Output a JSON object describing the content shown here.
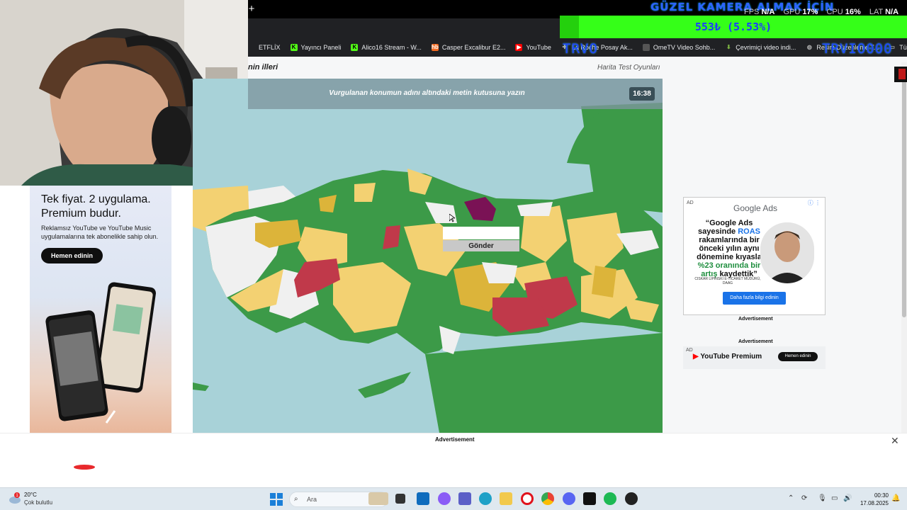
{
  "browser": {
    "new_tab": "+",
    "bookmarks": [
      {
        "label": "ETFLİX",
        "icon": "netflix-icon",
        "color": "#e50914"
      },
      {
        "label": "Yayıncı Paneli",
        "icon": "kick-icon",
        "color": "#53fc18"
      },
      {
        "label": "Alico16 Stream - W...",
        "icon": "kick-icon",
        "color": "#53fc18"
      },
      {
        "label": "Casper Excalibur E2...",
        "icon": "hb-icon",
        "color": "#f26a21"
      },
      {
        "label": "YouTube",
        "icon": "youtube-icon",
        "color": "#ff0000"
      },
      {
        "label": "La Roche Posay Ak...",
        "icon": "plus-icon",
        "color": "#7a7a7a"
      },
      {
        "label": "OmeTV Video Sohb...",
        "icon": "video-icon",
        "color": "#7a7a7a"
      },
      {
        "label": "Çevrimiçi video indi...",
        "icon": "download-icon",
        "color": "#7cb342"
      },
      {
        "label": "Resim Düzenleme T...",
        "icon": "globe-icon",
        "color": "#888888"
      },
      {
        "label": "Tüm Yer İşaretleri",
        "icon": "folder-icon",
        "color": "#888888"
      }
    ]
  },
  "stream": {
    "title": "GÜZEL KAMERA ALMAK İÇİN",
    "goal": "553₺ (5.53%)",
    "goal_progress": 0.0553,
    "perf": {
      "fps_label": "FPS",
      "fps": "N/A",
      "gpu_label": "GPU",
      "gpu": "17%",
      "cpu_label": "CPU",
      "cpu": "16%",
      "lat_label": "LAT",
      "lat": "N/A"
    },
    "overlay_left": "TRVO",
    "overlay_right": "TRVIO000"
  },
  "page": {
    "title": "nin illeri",
    "site_link": "Harita Test Oyunları",
    "question": "Vurgulanan konumun adını altındaki metin kutusuna yazın",
    "timer": "16:38",
    "answer_value": "",
    "submit_label": "Gönder"
  },
  "left_ad": {
    "headline": "Tek fiyat. 2 uygulama. Premium budur.",
    "body": "Reklamsız YouTube ve YouTube Music uygulamalarına tek abonelikle sahip olun.",
    "cta": "Hemen edinin"
  },
  "google_ad": {
    "ad_tag": "AD",
    "logo": "Google Ads",
    "line1": "“Google Ads sayesinde ",
    "line1b": "ROAS",
    "line2": " rakamlarında bir önceki yılın aynı dönemine kıyasla ",
    "line2b": "%23 oranında bir artış",
    "line3": " kaydettik”",
    "signature": "CISKAR LIPINSKI  E-TICARET MÜDÜRÜ, DAAG",
    "cta": "Daha fazla bilgi edinin",
    "label": "Advertisement"
  },
  "ytp_ad": {
    "ad_tag": "AD",
    "label": "Advertisement",
    "brand": "YouTube Premium",
    "cta": "Hemen edinin"
  },
  "bottom_ad": {
    "label": "Advertisement",
    "close": "✕"
  },
  "taskbar": {
    "temp": "20°C",
    "weather": "Çok bulutlu",
    "weather_badge": "1",
    "search_label": "Ara",
    "time": "00:30",
    "date": "17.08.2025"
  },
  "colors": {
    "sea": "#a8d2d8",
    "green": "#3c9a48",
    "yellow": "#f3d172",
    "gold": "#dcb43a",
    "red": "#c0394a",
    "purple": "#7a1255",
    "white": "#f0f0f0"
  }
}
